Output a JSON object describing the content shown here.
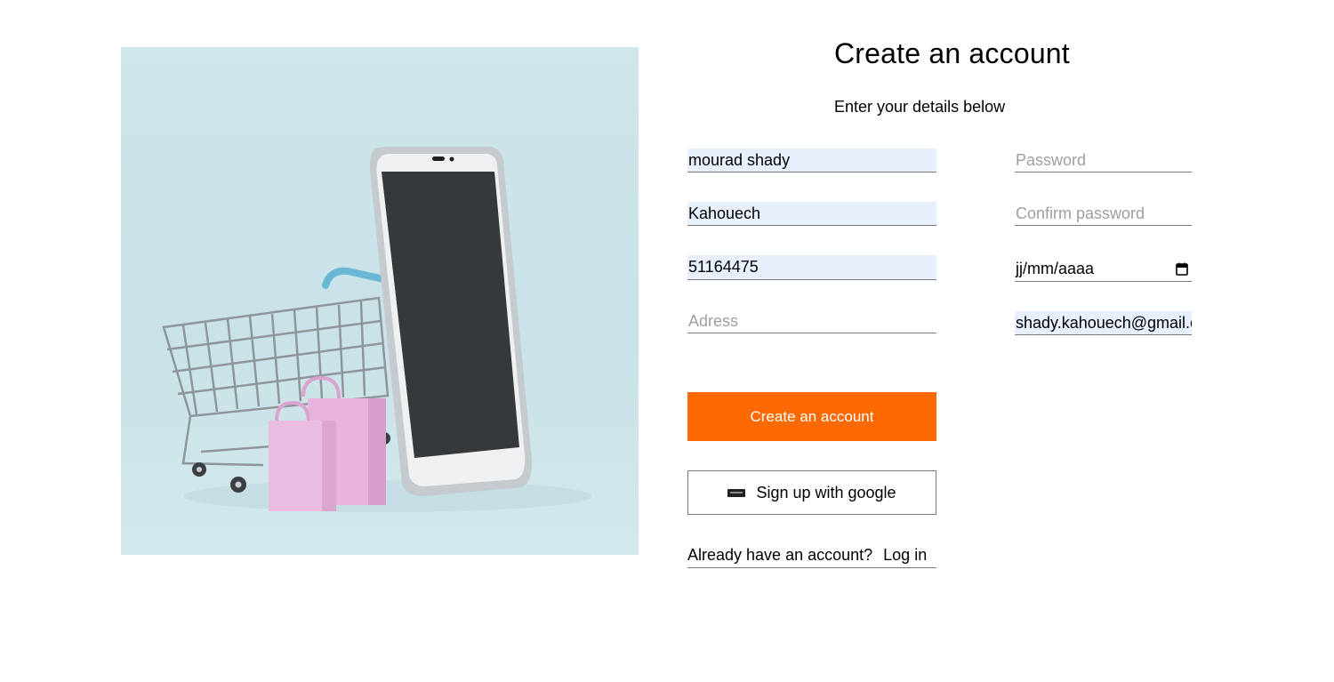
{
  "hero": {
    "image": "shopping-cart-smartphone-illustration"
  },
  "header": {
    "title": "Create an account",
    "subtitle": "Enter your details below"
  },
  "form": {
    "first_name": {
      "value": "mourad shady",
      "placeholder": ""
    },
    "last_name": {
      "value": "Kahouech",
      "placeholder": ""
    },
    "phone": {
      "value": "51164475",
      "placeholder": ""
    },
    "address": {
      "value": "",
      "placeholder": "Adress"
    },
    "password": {
      "value": "",
      "placeholder": "Password"
    },
    "confirm_password": {
      "value": "",
      "placeholder": "Confirm password"
    },
    "birthdate": {
      "display": "jj/mm/aaaa",
      "icon": "calendar-icon"
    },
    "email": {
      "value": "shady.kahouech@gmail.com",
      "placeholder": ""
    }
  },
  "actions": {
    "create_label": "Create an account",
    "google_label": "Sign up with google",
    "google_icon": "google-logo-icon"
  },
  "footer": {
    "prompt": "Already have an account?",
    "login_label": "Log in"
  },
  "colors": {
    "accent": "#fd6a03",
    "autofill_bg": "#e8f0fe",
    "hero_bg": "#cfe6ea"
  }
}
